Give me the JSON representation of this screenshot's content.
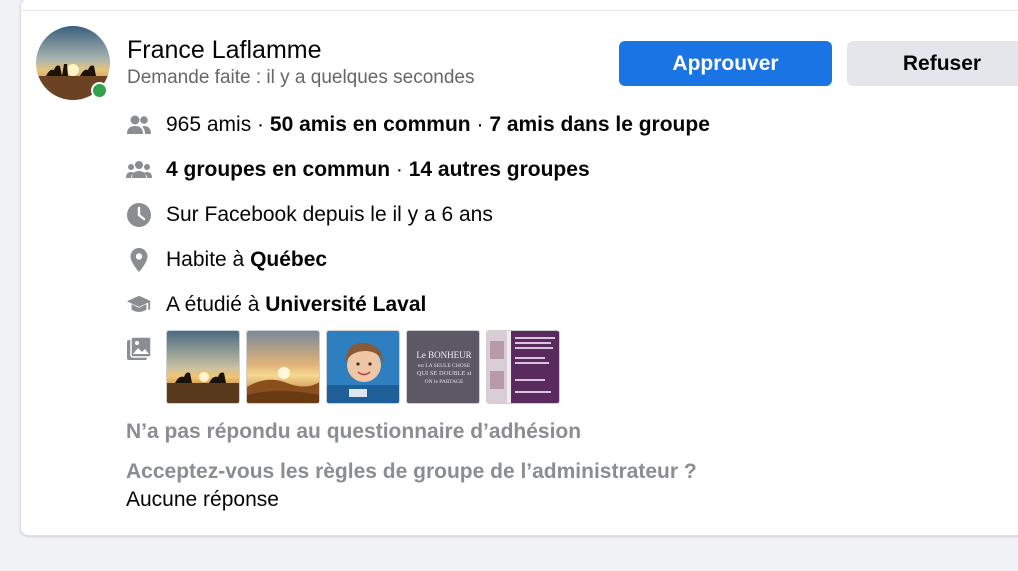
{
  "request": {
    "name": "France Laflamme",
    "requested": "Demande faite : il y a quelques secondes",
    "approve_label": "Approuver",
    "refuse_label": "Refuser"
  },
  "details": {
    "friends_count": "965 amis",
    "sep": " · ",
    "mutual_friends": "50 amis en commun",
    "friends_in_group": "7 amis dans le groupe",
    "mutual_groups": "4 groupes en commun",
    "other_groups": "14 autres groupes",
    "member_since": "Sur Facebook depuis le il y a 6 ans",
    "lives_prefix": "Habite à ",
    "lives_city": "Québec",
    "studied_prefix": "A étudié à ",
    "studied_school": "Université Laval"
  },
  "photos": {
    "thumb3_text": "",
    "thumb4_line1": "Le BONHEUR",
    "thumb4_line2": "est LA SEULE CHOSE",
    "thumb4_line3": "QUI SE DOUBLE si",
    "thumb4_line4": "ON le PARTAGE"
  },
  "questions": {
    "questionnaire": "N’a pas répondu au questionnaire d’adhésion",
    "rules_question": "Acceptez-vous les règles de groupe de l’administrateur ?",
    "rules_answer": "Aucune réponse"
  },
  "colors": {
    "primary_button": "#1b74e4",
    "secondary_button": "#e4e6eb",
    "online": "#31a24c",
    "muted_text": "#65676b",
    "icon": "#8a8d91"
  },
  "icons": [
    "friends-icon",
    "groups-icon",
    "clock-icon",
    "location-icon",
    "education-icon",
    "photos-icon"
  ]
}
